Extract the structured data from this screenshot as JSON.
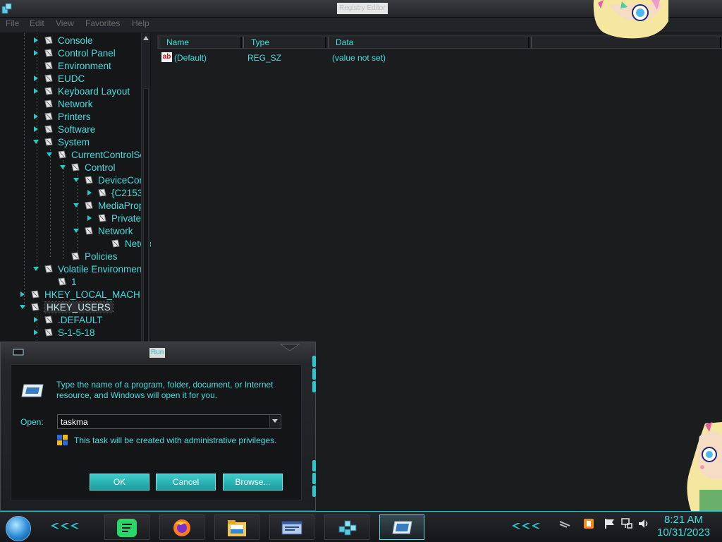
{
  "window": {
    "title": "Registry Editor"
  },
  "menu": [
    "File",
    "Edit",
    "View",
    "Favorites",
    "Help"
  ],
  "tree": [
    {
      "label": "Console",
      "expandable": true
    },
    {
      "label": "Control Panel",
      "expandable": true
    },
    {
      "label": "Environment",
      "expandable": false
    },
    {
      "label": "EUDC",
      "expandable": true
    },
    {
      "label": "Keyboard Layout",
      "expandable": true
    },
    {
      "label": "Network",
      "expandable": false
    },
    {
      "label": "Printers",
      "expandable": true
    },
    {
      "label": "Software",
      "expandable": true
    },
    {
      "label": "System",
      "expandable": true,
      "expanded": true
    },
    {
      "label": "CurrentControlSe",
      "expandable": true,
      "expanded": true
    },
    {
      "label": "Control",
      "expandable": true,
      "expanded": true
    },
    {
      "label": "DeviceCon",
      "expandable": true,
      "expanded": true
    },
    {
      "label": "{C2153",
      "expandable": true
    },
    {
      "label": "MediaProp",
      "expandable": true,
      "expanded": true
    },
    {
      "label": "Private",
      "expandable": true
    },
    {
      "label": "Network",
      "expandable": true,
      "expanded": true
    },
    {
      "label": "Networ",
      "expandable": false
    },
    {
      "label": "Policies",
      "expandable": false
    },
    {
      "label": "Volatile Environment",
      "expandable": true,
      "expanded": true
    },
    {
      "label": "1",
      "expandable": false
    },
    {
      "label": "HKEY_LOCAL_MACHII",
      "expandable": true
    },
    {
      "label": "HKEY_USERS",
      "expandable": true,
      "expanded": true,
      "selected": true
    },
    {
      "label": ".DEFAULT",
      "expandable": true
    },
    {
      "label": "S-1-5-18",
      "expandable": true
    }
  ],
  "list": {
    "columns": [
      "Name",
      "Type",
      "Data"
    ],
    "rows": [
      {
        "icon": "ab",
        "name": "(Default)",
        "type": "REG_SZ",
        "data": "(value not set)"
      }
    ]
  },
  "run": {
    "title": "Run",
    "description": "Type the name of a program, folder, document, or Internet resource, and Windows will open it for you.",
    "open_label": "Open:",
    "open_value": "taskma",
    "admin_note": "This task will be created with administrative privileges.",
    "ok_label": "OK",
    "cancel_label": "Cancel",
    "browse_label": "Browse..."
  },
  "taskbar": {
    "apps": [
      {
        "name": "spotify-icon"
      },
      {
        "name": "firefox-icon"
      },
      {
        "name": "file-explorer-icon"
      },
      {
        "name": "window-icon"
      },
      {
        "name": "regedit-icon"
      },
      {
        "name": "run-icon",
        "active": true
      }
    ],
    "clock_time": "8:21 AM",
    "clock_date": "10/31/2023"
  },
  "colors": {
    "accent": "#44dede",
    "background": "#1b1c1e",
    "button": "#2ab6b8"
  }
}
